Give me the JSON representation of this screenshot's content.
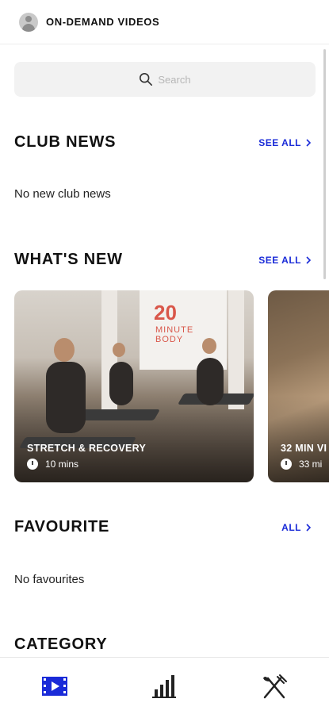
{
  "header": {
    "title": "ON-DEMAND VIDEOS",
    "avatar_icon": "user-avatar-icon"
  },
  "search": {
    "placeholder": "Search",
    "icon": "search-icon"
  },
  "club_news": {
    "title": "CLUB NEWS",
    "see_all": "SEE ALL",
    "empty": "No new club news"
  },
  "whats_new": {
    "title": "WHAT'S NEW",
    "see_all": "SEE ALL",
    "videos": [
      {
        "title": "STRETCH & RECOVERY",
        "duration": "10 mins",
        "banner": "20",
        "banner_sub": "MINUTE BODY"
      },
      {
        "title": "32 MIN VI",
        "duration": "33 mi"
      }
    ]
  },
  "favourite": {
    "title": "FAVOURITE",
    "see_all": "ALL",
    "empty": "No favourites"
  },
  "category": {
    "title": "CATEGORY"
  },
  "bottom_nav": {
    "items": [
      {
        "icon": "video-library-icon",
        "active": true
      },
      {
        "icon": "stats-bar-chart-icon",
        "active": false
      },
      {
        "icon": "fork-knife-icon",
        "active": false
      }
    ]
  },
  "colors": {
    "accent": "#1a2bd8",
    "text": "#111111",
    "muted": "#b7b7b7",
    "search_bg": "#f2f2f2"
  }
}
